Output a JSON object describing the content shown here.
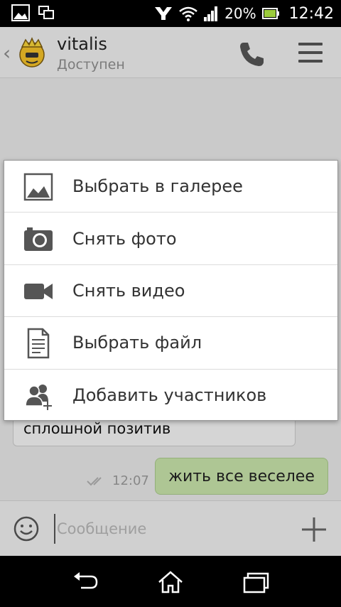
{
  "status_bar": {
    "battery_percent": "20%",
    "time": "12:42",
    "icons": [
      "gallery-notification-icon",
      "screen-mirror-icon",
      "app-notification-icon",
      "wifi-icon",
      "signal-icon",
      "battery-icon"
    ]
  },
  "header": {
    "contact_name": "vitalis",
    "presence": "Доступен",
    "icons": [
      "back-chevron-icon",
      "avatar",
      "phone-icon",
      "menu-icon"
    ]
  },
  "chat": {
    "incoming_message": "сплошной позитив",
    "outgoing_time": "12:07",
    "outgoing_message": "жить все веселее"
  },
  "input": {
    "placeholder": "Сообщение",
    "value": ""
  },
  "attach_menu": {
    "items": [
      {
        "label": "Выбрать в галерее",
        "icon": "gallery-icon"
      },
      {
        "label": "Снять фото",
        "icon": "camera-icon"
      },
      {
        "label": "Снять видео",
        "icon": "video-camera-icon"
      },
      {
        "label": "Выбрать файл",
        "icon": "file-icon"
      },
      {
        "label": "Добавить участников",
        "icon": "add-participants-icon"
      }
    ]
  },
  "nav_bar": {
    "icons": [
      "back-icon",
      "home-icon",
      "recent-apps-icon"
    ]
  },
  "colors": {
    "outgoing_bubble": "#c6e2a9",
    "header_bg": "#ededed",
    "menu_icon": "#555555"
  }
}
